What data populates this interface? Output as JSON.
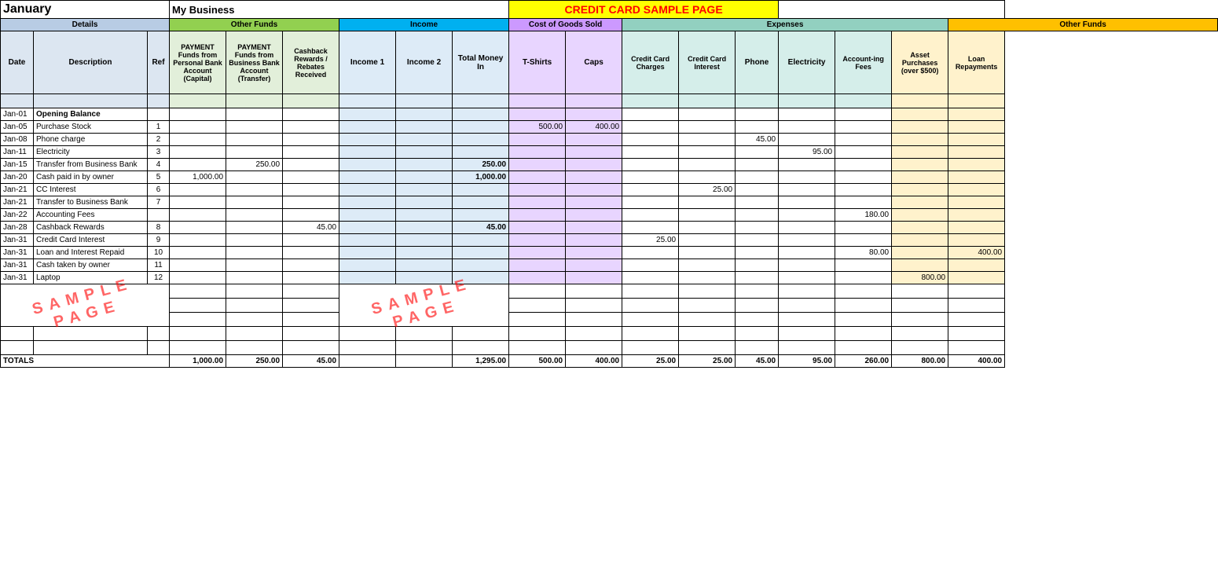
{
  "title": {
    "month": "January",
    "business": "My Business",
    "credit_card_title": "CREDIT CARD SAMPLE PAGE"
  },
  "sections": {
    "details": "Details",
    "other_funds": "Other Funds",
    "income": "Income",
    "cogs": "Cost of Goods Sold",
    "expenses": "Expenses",
    "other_funds2": "Other Funds"
  },
  "column_headers": {
    "date": "Date",
    "description": "Description",
    "ref": "Ref",
    "pay_personal": "PAYMENT Funds from Personal Bank Account (Capital)",
    "pay_business": "PAYMENT Funds from Business Bank Account (Transfer)",
    "cashback": "Cashback Rewards / Rebates Received",
    "income1": "Income 1",
    "income2": "Income 2",
    "total_money": "Total Money In",
    "tshirts": "T-Shirts",
    "caps": "Caps",
    "cc_charges": "Credit Card Charges",
    "cc_interest": "Credit Card Interest",
    "phone": "Phone",
    "electricity": "Electricity",
    "accounting": "Account-ing Fees",
    "asset": "Asset Purchases (over $500)",
    "loan": "Loan Repayments"
  },
  "rows": [
    {
      "date": "Jan-01",
      "desc": "Opening Balance",
      "ref": "",
      "pay_personal": "",
      "pay_business": "",
      "cashback": "",
      "income1": "",
      "income2": "",
      "total_money": "",
      "tshirts": "",
      "caps": "",
      "cc_charges": "",
      "cc_interest": "",
      "phone": "",
      "electricity": "",
      "accounting": "",
      "asset": "",
      "loan": "",
      "bold": true
    },
    {
      "date": "Jan-05",
      "desc": "Purchase Stock",
      "ref": "1",
      "pay_personal": "",
      "pay_business": "",
      "cashback": "",
      "income1": "",
      "income2": "",
      "total_money": "",
      "tshirts": "500.00",
      "caps": "400.00",
      "cc_charges": "",
      "cc_interest": "",
      "phone": "",
      "electricity": "",
      "accounting": "",
      "asset": "",
      "loan": ""
    },
    {
      "date": "Jan-08",
      "desc": "Phone charge",
      "ref": "2",
      "pay_personal": "",
      "pay_business": "",
      "cashback": "",
      "income1": "",
      "income2": "",
      "total_money": "",
      "tshirts": "",
      "caps": "",
      "cc_charges": "",
      "cc_interest": "",
      "phone": "45.00",
      "electricity": "",
      "accounting": "",
      "asset": "",
      "loan": ""
    },
    {
      "date": "Jan-11",
      "desc": "Electricity",
      "ref": "3",
      "pay_personal": "",
      "pay_business": "",
      "cashback": "",
      "income1": "",
      "income2": "",
      "total_money": "",
      "tshirts": "",
      "caps": "",
      "cc_charges": "",
      "cc_interest": "",
      "phone": "",
      "electricity": "95.00",
      "accounting": "",
      "asset": "",
      "loan": ""
    },
    {
      "date": "Jan-15",
      "desc": "Transfer from Business Bank",
      "ref": "4",
      "pay_personal": "",
      "pay_business": "250.00",
      "cashback": "",
      "income1": "",
      "income2": "",
      "total_money": "250.00",
      "tshirts": "",
      "caps": "",
      "cc_charges": "",
      "cc_interest": "",
      "phone": "",
      "electricity": "",
      "accounting": "",
      "asset": "",
      "loan": ""
    },
    {
      "date": "Jan-20",
      "desc": "Cash paid in by owner",
      "ref": "5",
      "pay_personal": "1,000.00",
      "pay_business": "",
      "cashback": "",
      "income1": "",
      "income2": "",
      "total_money": "1,000.00",
      "tshirts": "",
      "caps": "",
      "cc_charges": "",
      "cc_interest": "",
      "phone": "",
      "electricity": "",
      "accounting": "",
      "asset": "",
      "loan": ""
    },
    {
      "date": "Jan-21",
      "desc": "CC Interest",
      "ref": "6",
      "pay_personal": "",
      "pay_business": "",
      "cashback": "",
      "income1": "",
      "income2": "",
      "total_money": "",
      "tshirts": "",
      "caps": "",
      "cc_charges": "",
      "cc_interest": "25.00",
      "phone": "",
      "electricity": "",
      "accounting": "",
      "asset": "",
      "loan": ""
    },
    {
      "date": "Jan-21",
      "desc": "Transfer to Business Bank",
      "ref": "7",
      "pay_personal": "",
      "pay_business": "",
      "cashback": "",
      "income1": "",
      "income2": "",
      "total_money": "",
      "tshirts": "",
      "caps": "",
      "cc_charges": "",
      "cc_interest": "",
      "phone": "",
      "electricity": "",
      "accounting": "",
      "asset": "",
      "loan": ""
    },
    {
      "date": "Jan-22",
      "desc": "Accounting Fees",
      "ref": "",
      "pay_personal": "",
      "pay_business": "",
      "cashback": "",
      "income1": "",
      "income2": "",
      "total_money": "",
      "tshirts": "",
      "caps": "",
      "cc_charges": "",
      "cc_interest": "",
      "phone": "",
      "electricity": "",
      "accounting": "180.00",
      "asset": "",
      "loan": ""
    },
    {
      "date": "Jan-28",
      "desc": "Cashback Rewards",
      "ref": "8",
      "pay_personal": "",
      "pay_business": "",
      "cashback": "45.00",
      "income1": "",
      "income2": "",
      "total_money": "45.00",
      "tshirts": "",
      "caps": "",
      "cc_charges": "",
      "cc_interest": "",
      "phone": "",
      "electricity": "",
      "accounting": "",
      "asset": "",
      "loan": ""
    },
    {
      "date": "Jan-31",
      "desc": "Credit Card Interest",
      "ref": "9",
      "pay_personal": "",
      "pay_business": "",
      "cashback": "",
      "income1": "",
      "income2": "",
      "total_money": "",
      "tshirts": "",
      "caps": "",
      "cc_charges": "25.00",
      "cc_interest": "",
      "phone": "",
      "electricity": "",
      "accounting": "",
      "asset": "",
      "loan": ""
    },
    {
      "date": "Jan-31",
      "desc": "Loan and Interest Repaid",
      "ref": "10",
      "pay_personal": "",
      "pay_business": "",
      "cashback": "",
      "income1": "",
      "income2": "",
      "total_money": "",
      "tshirts": "",
      "caps": "",
      "cc_charges": "",
      "cc_interest": "",
      "phone": "",
      "electricity": "",
      "accounting": "80.00",
      "asset": "",
      "loan": "400.00"
    },
    {
      "date": "Jan-31",
      "desc": "Cash taken by owner",
      "ref": "11",
      "pay_personal": "",
      "pay_business": "",
      "cashback": "",
      "income1": "",
      "income2": "",
      "total_money": "",
      "tshirts": "",
      "caps": "",
      "cc_charges": "",
      "cc_interest": "",
      "phone": "",
      "electricity": "",
      "accounting": "",
      "asset": "",
      "loan": ""
    },
    {
      "date": "Jan-31",
      "desc": "Laptop",
      "ref": "12",
      "pay_personal": "",
      "pay_business": "",
      "cashback": "",
      "income1": "",
      "income2": "",
      "total_money": "",
      "tshirts": "",
      "caps": "",
      "cc_charges": "",
      "cc_interest": "",
      "phone": "",
      "electricity": "",
      "accounting": "",
      "asset": "800.00",
      "loan": ""
    }
  ],
  "totals": {
    "label": "TOTALS",
    "pay_personal": "1,000.00",
    "pay_business": "250.00",
    "cashback": "45.00",
    "income1": "",
    "income2": "",
    "total_money": "1,295.00",
    "tshirts": "500.00",
    "caps": "400.00",
    "cc_charges": "25.00",
    "cc_interest": "25.00",
    "phone": "45.00",
    "electricity": "95.00",
    "accounting": "260.00",
    "asset": "800.00",
    "loan": "400.00"
  },
  "sample_page_text1": "SAMPLE PAGE",
  "sample_page_text2": "SAMPLE PAGE"
}
